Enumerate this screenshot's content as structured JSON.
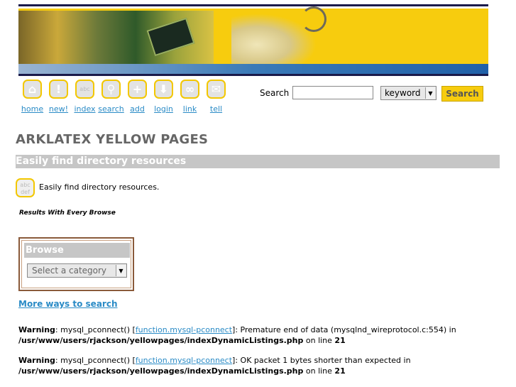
{
  "banner": {
    "alt": "banner image"
  },
  "nav": [
    {
      "name": "home",
      "label": "home",
      "icon": "house-icon",
      "glyph": "⌂"
    },
    {
      "name": "new",
      "label": "new!",
      "icon": "exclamation-icon",
      "glyph": "!"
    },
    {
      "name": "index",
      "label": "index",
      "icon": "abc-icon",
      "glyph": "abc"
    },
    {
      "name": "search",
      "label": "search",
      "icon": "magnifier-icon",
      "glyph": "⚲"
    },
    {
      "name": "add",
      "label": "add",
      "icon": "plus-icon",
      "glyph": "+"
    },
    {
      "name": "login",
      "label": "login",
      "icon": "down-arrow-icon",
      "glyph": "⬇"
    },
    {
      "name": "link",
      "label": "link",
      "icon": "chain-link-icon",
      "glyph": "∞"
    },
    {
      "name": "tell",
      "label": "tell",
      "icon": "envelope-icon",
      "glyph": "✉"
    }
  ],
  "search": {
    "label": "Search",
    "value": "",
    "type_selected": "keyword",
    "button": "Search"
  },
  "page_title": "ARKLATEX YELLOW PAGES",
  "section_title": "Easily find directory resources",
  "description": "Easily find directory resources.",
  "sub_note": "Results With Every Browse",
  "browse": {
    "heading": "Browse",
    "select_value": "Select a category"
  },
  "more_link": "More ways to search",
  "warnings": [
    {
      "label": "Warning",
      "pre": ": mysql_pconnect() [",
      "link": "function.mysql-pconnect",
      "post": "]: Premature end of data (mysqlnd_wireprotocol.c:554) in",
      "path": "/usr/www/users/rjackson/yellowpages/indexDynamicListings.php",
      "online": " on line ",
      "line": "21"
    },
    {
      "label": "Warning",
      "pre": ": mysql_pconnect() [",
      "link": "function.mysql-pconnect",
      "post": "]: OK packet 1 bytes shorter than expected in",
      "path": "/usr/www/users/rjackson/yellowpages/indexDynamicListings.php",
      "online": " on line ",
      "line": "21"
    }
  ],
  "colors": {
    "accent_yellow": "#f7cc0e",
    "link_blue": "#2a8bc6",
    "bar_gray": "#c6c6c6"
  }
}
